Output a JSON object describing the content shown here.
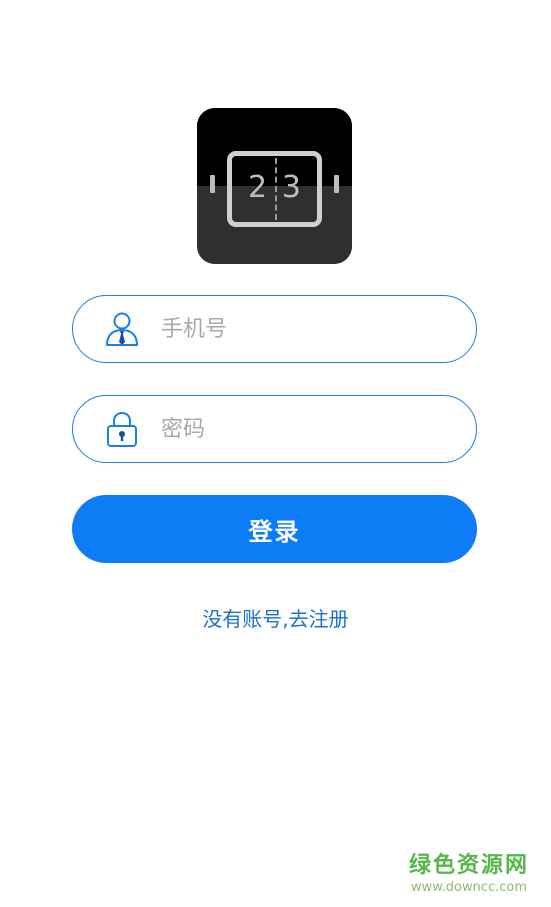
{
  "logo": {
    "digit_left": "2",
    "digit_right": "3"
  },
  "login_form": {
    "phone_placeholder": "手机号",
    "phone_value": "",
    "password_placeholder": "密码",
    "password_value": "",
    "login_label": "登录",
    "register_link": "没有账号,去注册"
  },
  "icons": {
    "phone_field_icon": "user-icon",
    "password_field_icon": "lock-icon"
  },
  "colors": {
    "accent": "#0f7cf7",
    "field_border": "#1a7fe6",
    "link": "#1a73c9"
  },
  "watermark": {
    "title": "绿色资源网",
    "url": "www.downcc.com"
  }
}
